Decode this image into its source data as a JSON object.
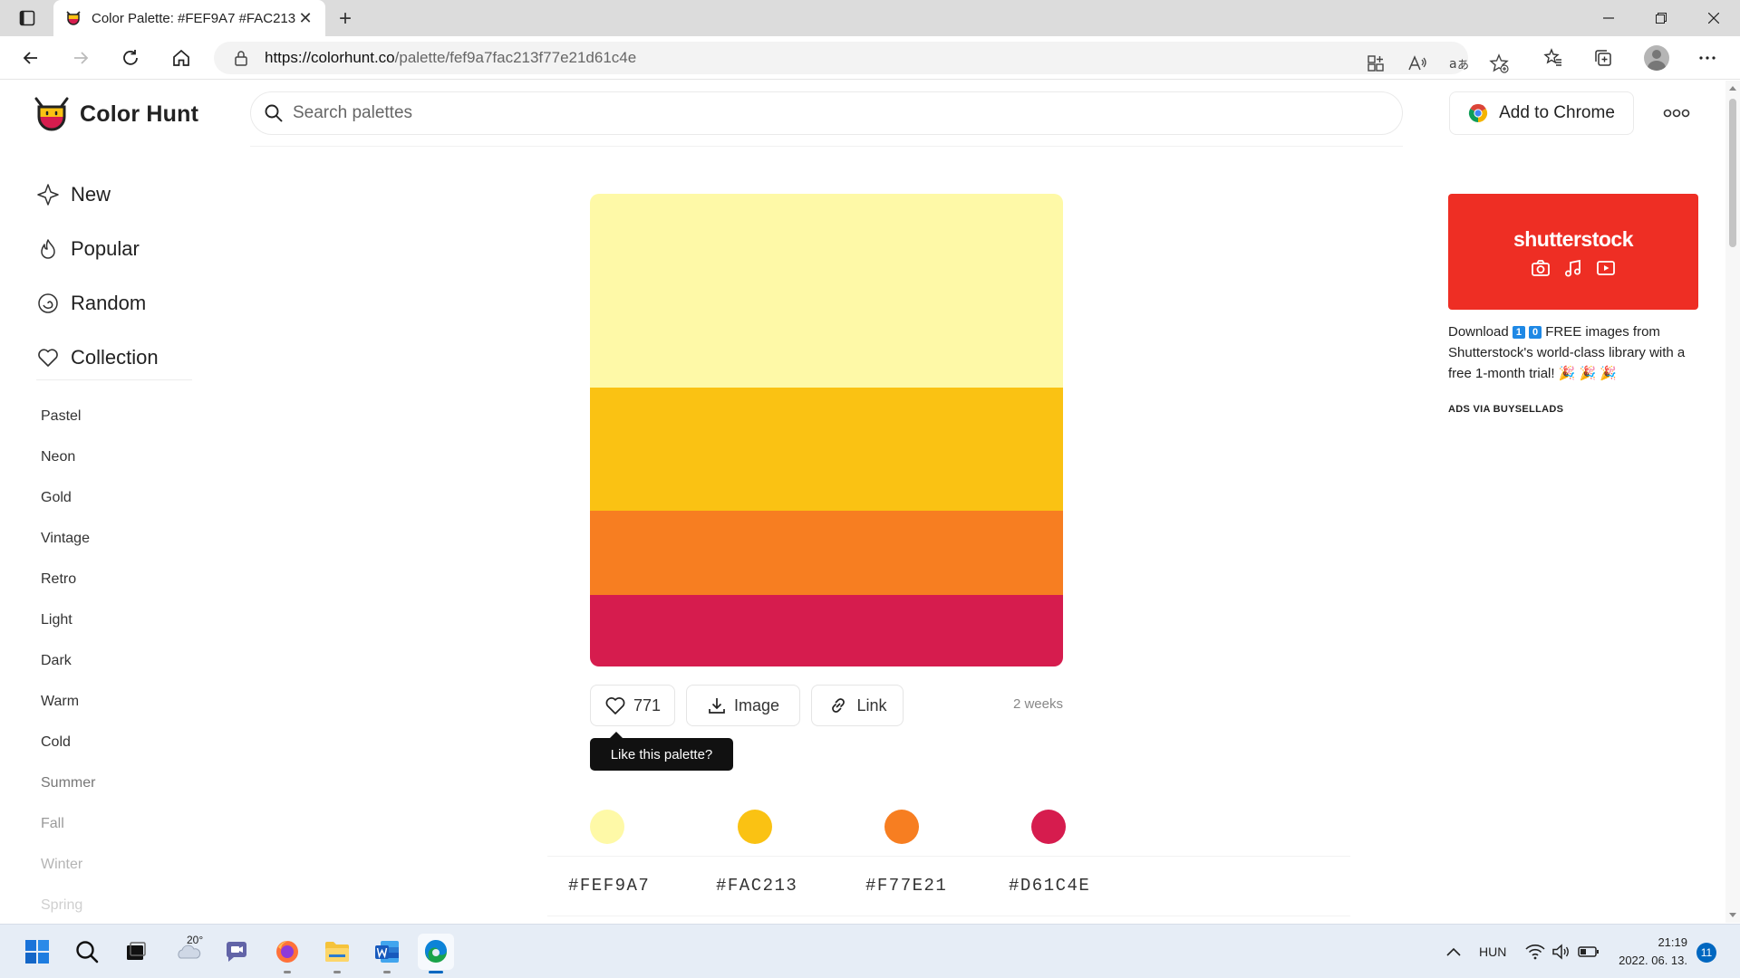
{
  "browser": {
    "tab_title": "Color Palette: #FEF9A7 #FAC213",
    "tab_close": "✕",
    "new_tab": "+",
    "url_host": "https://colorhunt.co",
    "url_path": "/palette/fef9a7fac213f77e21d61c4e"
  },
  "header": {
    "logo_text": "Color Hunt",
    "search_placeholder": "Search palettes",
    "add_to_chrome": "Add to Chrome"
  },
  "sidebar": {
    "main": [
      {
        "label": "New",
        "icon": "sparkle-icon"
      },
      {
        "label": "Popular",
        "icon": "flame-icon"
      },
      {
        "label": "Random",
        "icon": "spiral-icon"
      },
      {
        "label": "Collection",
        "icon": "heart-icon"
      }
    ],
    "tags": [
      "Pastel",
      "Neon",
      "Gold",
      "Vintage",
      "Retro",
      "Light",
      "Dark",
      "Warm",
      "Cold",
      "Summer",
      "Fall",
      "Winter",
      "Spring"
    ]
  },
  "palette": {
    "colors": [
      {
        "hex": "#FEF9A7",
        "css": "#fef9a7"
      },
      {
        "hex": "#FAC213",
        "css": "#fac213"
      },
      {
        "hex": "#F77E21",
        "css": "#f77e21"
      },
      {
        "hex": "#D61C4E",
        "css": "#d61c4e"
      }
    ],
    "likes": "771",
    "image_label": "Image",
    "link_label": "Link",
    "age": "2 weeks",
    "tooltip": "Like this palette?"
  },
  "ad": {
    "brand": "shutterstock",
    "text_before": "Download",
    "num1": "1",
    "num2": "0",
    "text_after": "FREE images from Shutterstock's world-class library with a free 1-month trial! 🎉 🎉 🎉",
    "via": "ADS VIA BUYSELLADS"
  },
  "taskbar": {
    "weather_temp": "20°",
    "language": "HUN",
    "time": "21:19",
    "date": "2022. 06. 13.",
    "notifications": "11"
  }
}
